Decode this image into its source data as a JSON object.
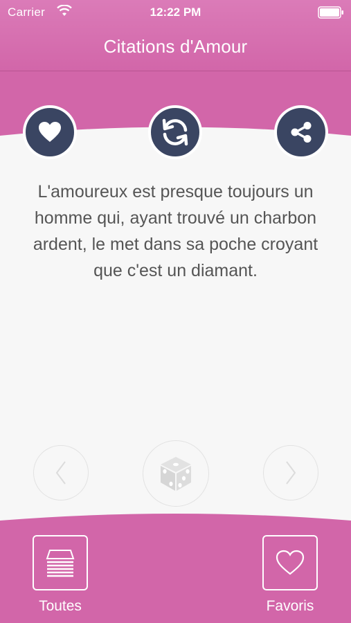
{
  "status_bar": {
    "carrier": "Carrier",
    "time": "12:22 PM"
  },
  "header": {
    "title": "Citations d'Amour"
  },
  "actions": {
    "favorite_icon": "heart-icon",
    "refresh_icon": "refresh-icon",
    "share_icon": "share-icon"
  },
  "quote": {
    "text": "L'amoureux est presque toujours un homme qui, ayant trouvé un charbon ardent, le met dans sa poche croyant que c'est un diamant."
  },
  "navigation": {
    "prev_icon": "chevron-left-icon",
    "random_icon": "dice-icon",
    "next_icon": "chevron-right-icon"
  },
  "tabbar": {
    "all_label": "Toutes",
    "favorites_label": "Favoris"
  },
  "colors": {
    "brand_pink": "#d266a9",
    "button_navy": "#3a4562",
    "background": "#f7f7f7"
  }
}
